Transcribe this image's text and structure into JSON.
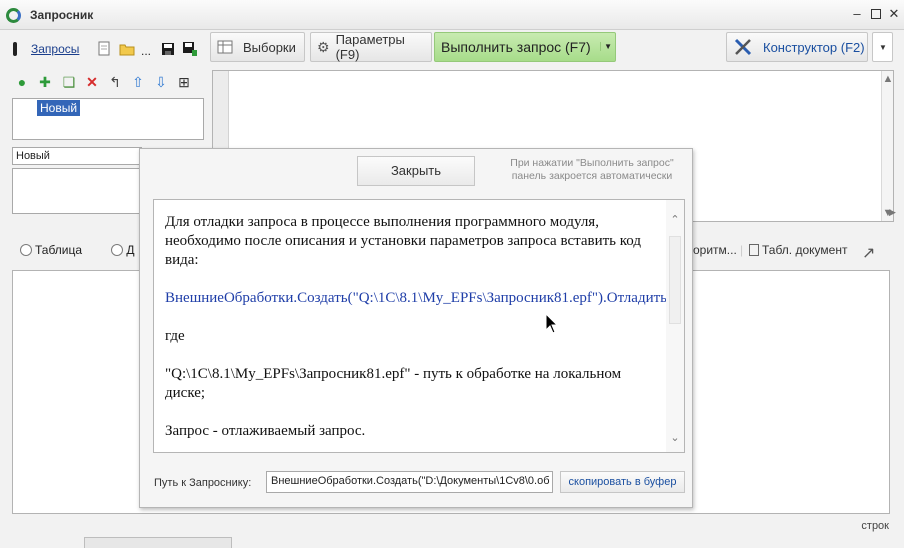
{
  "window": {
    "title": "Запросник"
  },
  "toolbar": {
    "queries_link": "Запросы",
    "ellipsis": "...",
    "selections_button": "Выборки",
    "params_button": "Параметры (F9)",
    "execute_button": "Выполнить запрос (F7)",
    "constructor_button": "Конструктор (F2)"
  },
  "queries_list": {
    "selected_item": "Новый"
  },
  "query_name": {
    "value": "Новый"
  },
  "result": {
    "radio_table": "Таблица",
    "radio_second_prefix": "Д",
    "algorithm_option": "оритм...",
    "tabdoc_option": "Табл. документ",
    "status_label": "строк"
  },
  "popup": {
    "close_button": "Закрыть",
    "hint": "При нажатии \"Выполнить запрос\" панель закроется автоматически",
    "help": {
      "paragraph1": "Для отладки запроса в процессе выполнения программного модуля, необходимо после описания и установки параметров запроса вставить код вида:",
      "code": "ВнешниеОбработки.Создать(\"Q:\\1C\\8.1\\My_EPFs\\Запросник81.epf\").Отладить(Запрос);",
      "paragraph2": "где",
      "paragraph3": "\"Q:\\1C\\8.1\\My_EPFs\\Запросник81.epf\" - путь к обработке на локальном диске;",
      "paragraph4": "Запрос - отлаживаемый запрос."
    },
    "path_label": "Путь к Запроснику:",
    "path_value": "ВнешниеОбработки.Создать(\"D:\\Документы\\1Cv8\\0.об",
    "copy_button": "скопировать в буфер"
  },
  "colors": {
    "execute_button_bg": "#b4e29a",
    "selection_bg": "#3366b8",
    "link": "#1a3e8c"
  }
}
